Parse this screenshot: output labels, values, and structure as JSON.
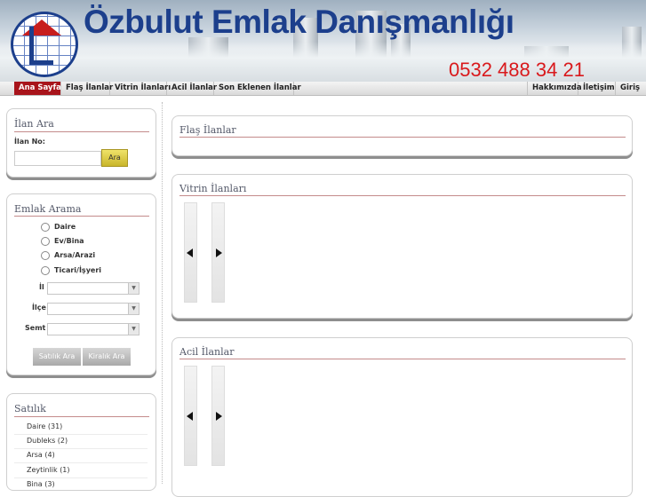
{
  "header": {
    "title": "Özbulut Emlak Danışmanlığı",
    "phone": "0532 488 34 21"
  },
  "nav": {
    "left": [
      "Ana Sayfa",
      "Flaş İlanlar",
      "Vitrin İlanları",
      "Acil İlanlar",
      "Son Eklenen İlanlar"
    ],
    "right": [
      "Hakkımızda",
      "İletişim",
      "Giriş"
    ],
    "active": "Ana Sayfa",
    "active_color": "#a8141b"
  },
  "ilan_ara": {
    "title": "İlan Ara",
    "label": "İlan No:",
    "value": "",
    "button": "Ara"
  },
  "emlak_arama": {
    "title": "Emlak Arama",
    "types": [
      "Daire",
      "Ev/Bina",
      "Arsa/Arazi",
      "Ticari/İşyeri"
    ],
    "selects": [
      "İl",
      "İlçe",
      "Semt"
    ],
    "buttons": [
      "Satılık Ara",
      "Kiralık Ara"
    ]
  },
  "satilik": {
    "title": "Satılık",
    "items": [
      "Daire (31)",
      "Dubleks (2)",
      "Arsa (4)",
      "Zeytinlik (1)",
      "Bina (3)"
    ]
  },
  "sections": {
    "flas": "Flaş İlanlar",
    "vitrin": "Vitrin İlanları",
    "acil": "Acil İlanlar"
  },
  "icons": {
    "prev": "triangle-left-icon",
    "next": "triangle-right-icon"
  },
  "colors": {
    "brand_blue": "#1c3f8c",
    "phone_red": "#d9191c",
    "button_yellow": "#e6d54a"
  }
}
